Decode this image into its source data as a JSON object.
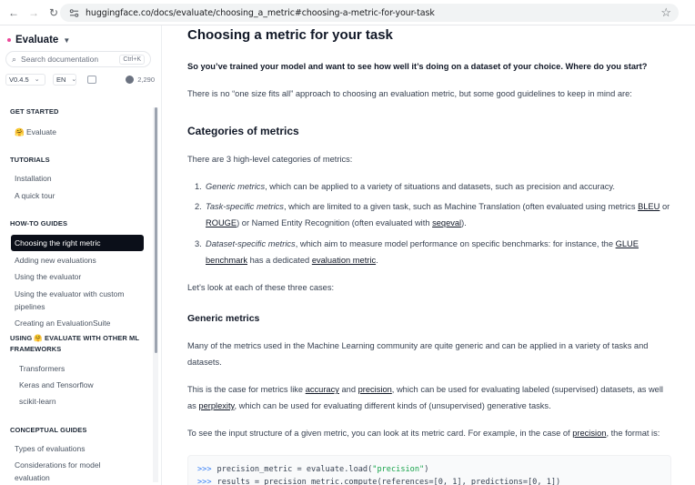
{
  "browser": {
    "back_icon": "back-arrow-icon",
    "forward_icon": "forward-arrow-icon",
    "reload_icon": "reload-icon",
    "url": "huggingface.co/docs/evaluate/choosing_a_metric#choosing-a-metric-for-your-task"
  },
  "sidebar": {
    "brand": "Evaluate",
    "search_placeholder": "Search documentation",
    "search_shortcut": "Ctrl+K",
    "version": "V0.4.5",
    "language": "EN",
    "github_stars": "2,290",
    "sections": [
      {
        "title": "GET STARTED",
        "items": [
          "🤗 Evaluate"
        ]
      },
      {
        "title": "TUTORIALS",
        "items": [
          "Installation",
          "A quick tour"
        ]
      },
      {
        "title": "HOW-TO GUIDES",
        "items": [
          "Choosing the right metric",
          "Adding new evaluations",
          "Using the evaluator",
          "Using the evaluator with custom",
          "pipelines",
          "Creating an EvaluationSuite"
        ]
      },
      {
        "title": "USING 🤗 EVALUATE WITH OTHER ML",
        "title2": "FRAMEWORKS",
        "items": [
          "Transformers",
          "Keras and Tensorflow",
          "scikit-learn"
        ]
      },
      {
        "title": "CONCEPTUAL GUIDES",
        "items": [
          "Types of evaluations",
          "Considerations for model",
          "evaluation"
        ]
      }
    ]
  },
  "main": {
    "title": "Choosing a metric for your task",
    "intro_bold": "So you’ve trained your model and want to see how well it’s doing on a dataset of your choice. Where do you start?",
    "intro": "There is no “one size fits all” approach to choosing an evaluation metric, but some good guidelines to keep in mind are:",
    "categories_heading": "Categories of metrics",
    "categories_intro": "There are 3 high-level categories of metrics:",
    "list": {
      "n1": "1.",
      "n2": "2.",
      "n3": "3.",
      "i1_em": "Generic metrics",
      "i1_rest": ", which can be applied to a variety of situations and datasets, such as precision and accuracy.",
      "i2_em": "Task-specific metrics",
      "i2_a": ", which are limited to a given task, such as Machine Translation (often evaluated using metrics ",
      "i2_bleu": "BLEU",
      "i2_or": " or",
      "i2_rouge": "ROUGE",
      "i2_b": ") or Named Entity Recognition (often evaluated with ",
      "i2_seqeval": "seqeval",
      "i2_end": ").",
      "i3_em": "Dataset-specific metrics",
      "i3_a": ", which aim to measure model performance on specific benchmarks: for instance, the ",
      "i3_glue": "GLUE",
      "i3_benchmark": "benchmark",
      "i3_b": " has a dedicated ",
      "i3_evalmetric": "evaluation metric",
      "i3_end": "."
    },
    "cases": "Let’s look at each of these three cases:",
    "generic_heading": "Generic metrics",
    "generic_p1": "Many of the metrics used in the Machine Learning community are quite generic and can be applied in a variety of tasks and",
    "generic_p1b": "datasets.",
    "generic_p2": {
      "a": "This is the case for metrics like ",
      "accuracy": "accuracy",
      "and": " and ",
      "precision": "precision",
      "b": ", which can be used for evaluating labeled (supervised) datasets, as well",
      "as": "as ",
      "perplexity": "perplexity",
      "c": ", which can be used for evaluating different kinds of (unsupervised) generative tasks."
    },
    "generic_p3": {
      "a": "To see the input structure of a given metric, you can look at its metric card. For example, in the case of ",
      "precision": "precision",
      "b": ", the format is:"
    },
    "code": {
      "prompt": ">>>",
      "l1_a": "precision_metric = evaluate.load(",
      "l1_str": "\"precision\"",
      "l1_b": ")",
      "l2": "results = precision_metric.compute(references=[0, 1], predictions=[0, 1])"
    }
  }
}
